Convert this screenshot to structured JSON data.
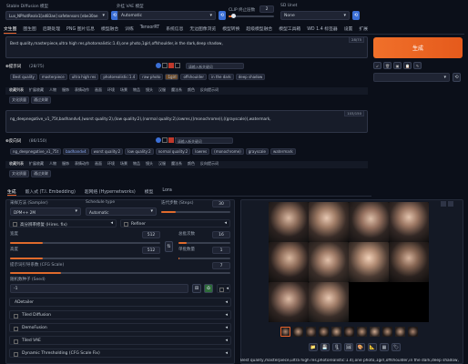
{
  "top": {
    "model_label": "Stable Diffusion 模型",
    "model_value": "Lux_NPhotRealv1[ad83ae] safetensors [ebe30ae",
    "vae_label": "外挂 VAE 模型",
    "vae_value": "Automatic",
    "clip_label": "CLIP 终止层数",
    "clip_value": "2",
    "sdunet_label": "SD Unet",
    "sdunet_value": "None"
  },
  "nav_tabs": [
    "文生图",
    "图生图",
    "后期处理",
    "PNG 图片信息",
    "模型融合",
    "训练",
    "TensorRT",
    "系统信息",
    "无边图像浏览",
    "模型转换",
    "超级模型融合",
    "模型工具箱",
    "WD 1.4 标签器",
    "设置",
    "扩展"
  ],
  "prompt": {
    "text": "Best quality,masterpiece,ultra high res,photorealistic:1.4),one photo,1girl,offshoulder,in the dark,deep shadow,",
    "counter": "28/75",
    "helper_title": "⊕提示词",
    "helper_count": "(28/75)",
    "input_placeholder": "请输入新关键词",
    "tags": [
      "Best quality",
      "masterpiece",
      "ultra high res",
      "photorealistic:1.4",
      "raw photo",
      "1girl",
      "offshoulder",
      "in the dark",
      "deep shadow"
    ],
    "categories": [
      "收藏列表",
      "扩展收藏",
      "人物",
      "服饰",
      "表情动作",
      "画面",
      "环境",
      "场景",
      "物品",
      "镜头",
      "汉服",
      "魔法系",
      "颜色",
      "反向提示词"
    ],
    "subcats": [
      "文化质量",
      "通过关联"
    ]
  },
  "negative": {
    "text": "ng_deepnegative_v1_75t,badhandv4,(worst quality:2),(low quality:2),(normal quality:2),lowres,((monochrome)),((grayscale)),watermark,",
    "counter": "103/150",
    "helper_title": "⊕反向词",
    "helper_count": "(86/150)",
    "input_placeholder": "请输入新关键词",
    "tags": [
      "ng_deepnegative_v1_75t",
      "badhandv4",
      "worst quality:2",
      "low quality:2",
      "normal quality:2",
      "lowres",
      "(monochrome)",
      "grayscale",
      "watermark"
    ],
    "categories": [
      "收藏列表",
      "扩展收藏",
      "人物",
      "服饰",
      "表情动作",
      "画面",
      "环境",
      "场景",
      "物品",
      "镜头",
      "汉服",
      "魔法系",
      "颜色",
      "反向提示词"
    ],
    "subcats": [
      "文化质量",
      "通过关联"
    ]
  },
  "generate_label": "生成",
  "sub_tabs": [
    "生成",
    "嵌入式 (T.I. Embedding)",
    "超网络 (Hypernetworks)",
    "模型",
    "Lora"
  ],
  "params": {
    "sampler_label": "采样方法 (Sampler)",
    "sampler_value": "DPM++ 2M",
    "schedule_label": "Schedule type",
    "schedule_value": "Automatic",
    "steps_label": "迭代步数 (Steps)",
    "steps_value": "30",
    "steps_fraction": 0.21,
    "hires_label": "高分辨率修复 (Hires. fix)",
    "refiner_label": "Refiner",
    "width_label": "宽度",
    "width_value": "512",
    "width_fraction": 0.22,
    "height_label": "高度",
    "height_value": "512",
    "height_fraction": 0.22,
    "batch_count_label": "总批次数",
    "batch_count_value": "16",
    "batch_count_fraction": 0.15,
    "batch_size_label": "单批数量",
    "batch_size_value": "1",
    "batch_size_fraction": 0.02,
    "cfg_label": "提示词引导系数 (CFG Scale)",
    "cfg_value": "7",
    "cfg_fraction": 0.23,
    "seed_label": "随机数种子 (Seed)",
    "seed_value": "-1"
  },
  "accordions": [
    "ADetailer",
    "Tiled Diffusion",
    "DemoFusion",
    "Tiled VAE",
    "Dynamic Thresholding (CFG Scale Fix)"
  ],
  "output_caption": "Best quality,masterpiece,ultra high res,photorealistic:1.4),one photo,1girl,offshoulder,in the dark,deep shadow,",
  "colors": {
    "accent": "#e8632a",
    "bg": "#0b0f19",
    "panel": "#141925",
    "blue": "#3b6fd6"
  }
}
